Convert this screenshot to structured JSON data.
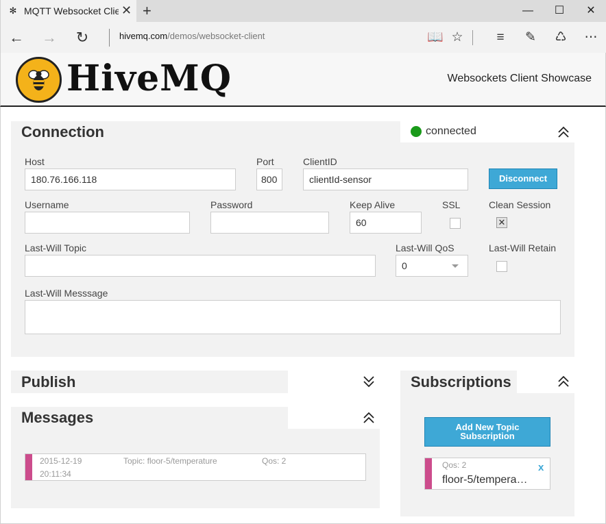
{
  "browser": {
    "tab_title": "MQTT Websocket Client",
    "new_tab": "+",
    "address_host": "hivemq.com",
    "address_path": "/demos/websocket-client"
  },
  "header": {
    "logo_text": "HiveMQ",
    "showcase": "Websockets Client Showcase"
  },
  "connection": {
    "title": "Connection",
    "status": "connected",
    "status_color": "#1a9a1a",
    "host_label": "Host",
    "host_value": "180.76.166.118",
    "port_label": "Port",
    "port_value": "800",
    "clientid_label": "ClientID",
    "clientid_value": "clientId-sensor",
    "disconnect_label": "Disconnect",
    "username_label": "Username",
    "username_value": "",
    "password_label": "Password",
    "password_value": "",
    "keepalive_label": "Keep Alive",
    "keepalive_value": "60",
    "ssl_label": "SSL",
    "ssl_checked": false,
    "clean_label": "Clean Session",
    "clean_checked": true,
    "lastwill_topic_label": "Last-Will Topic",
    "lastwill_topic_value": "",
    "lastwill_qos_label": "Last-Will QoS",
    "lastwill_qos_value": "0",
    "lastwill_retain_label": "Last-Will Retain",
    "lastwill_retain_checked": false,
    "lastwill_message_label": "Last-Will Messsage",
    "lastwill_message_value": ""
  },
  "publish": {
    "title": "Publish"
  },
  "messages": {
    "title": "Messages",
    "items": [
      {
        "date": "2015-12-19",
        "time": "20:11:34",
        "topic": "Topic: floor-5/temperature",
        "qos": "Qos: 2",
        "color": "#cc4c8c"
      }
    ]
  },
  "subscriptions": {
    "title": "Subscriptions",
    "add_label": "Add New Topic Subscription",
    "items": [
      {
        "qos": "Qos: 2",
        "topic": "floor-5/tempera…",
        "remove": "x",
        "color": "#cc4c8c"
      }
    ]
  },
  "accent_color": "#3ea8d6"
}
